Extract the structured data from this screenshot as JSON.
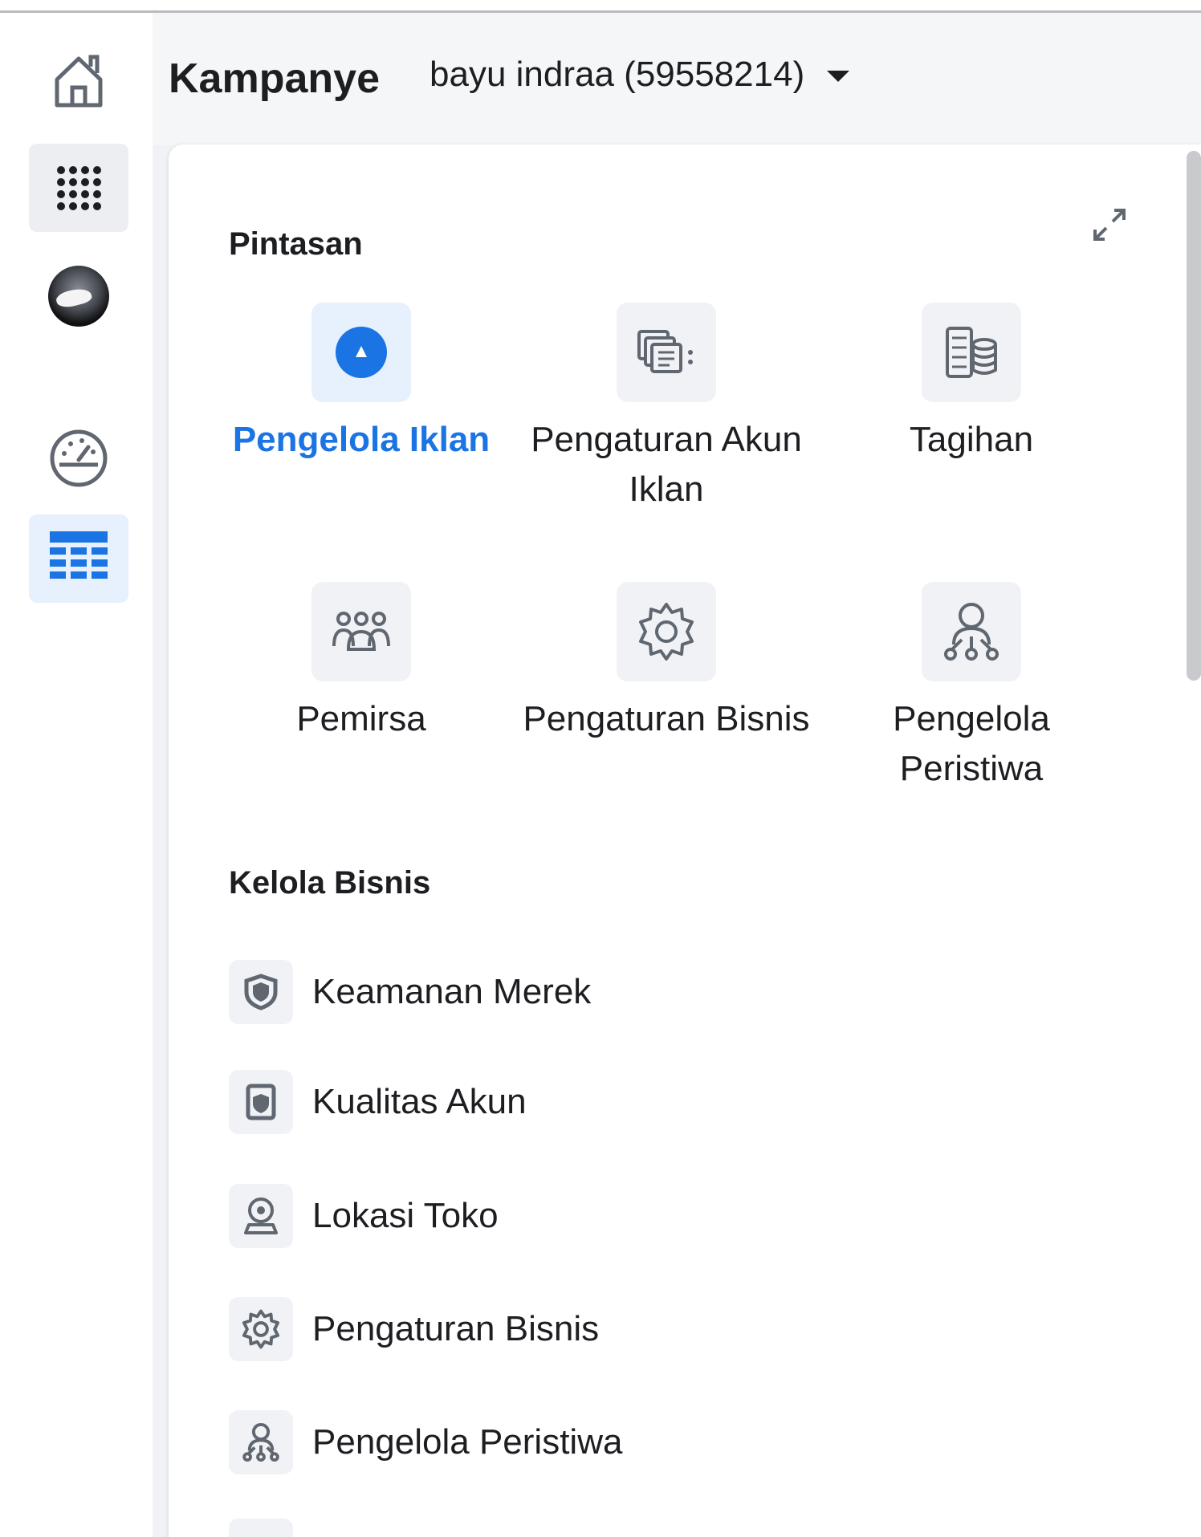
{
  "header": {
    "title": "Kampanye",
    "account": "bayu indraa (59558214)"
  },
  "rail": {
    "items": [
      {
        "icon": "home-icon"
      },
      {
        "icon": "apps-grid-icon"
      },
      {
        "icon": "avatar"
      },
      {
        "icon": "dashboard-gauge-icon"
      },
      {
        "icon": "table-grid-icon",
        "active": true
      }
    ]
  },
  "panel": {
    "shortcuts_title": "Pintasan",
    "shortcuts": [
      {
        "label": "Pengelola Iklan",
        "icon": "ads-manager-icon",
        "active": true
      },
      {
        "label": "Pengaturan Akun Iklan",
        "icon": "ad-account-settings-icon"
      },
      {
        "label": "Tagihan",
        "icon": "billing-icon"
      },
      {
        "label": "Pemirsa",
        "icon": "audience-icon"
      },
      {
        "label": "Pengaturan Bisnis",
        "icon": "gear-icon"
      },
      {
        "label": "Pengelola Peristiwa",
        "icon": "events-manager-icon"
      }
    ],
    "manage_title": "Kelola Bisnis",
    "manage_items": [
      {
        "label": "Keamanan Merek",
        "icon": "shield-icon"
      },
      {
        "label": "Kualitas Akun",
        "icon": "account-quality-icon"
      },
      {
        "label": "Lokasi Toko",
        "icon": "store-location-icon"
      },
      {
        "label": "Pengaturan Bisnis",
        "icon": "gear-icon"
      },
      {
        "label": "Pengelola Peristiwa",
        "icon": "events-manager-icon"
      }
    ]
  },
  "colors": {
    "accent": "#1b74e4",
    "active_bg": "#e7f0fd",
    "tile_bg": "#f0f2f5"
  }
}
